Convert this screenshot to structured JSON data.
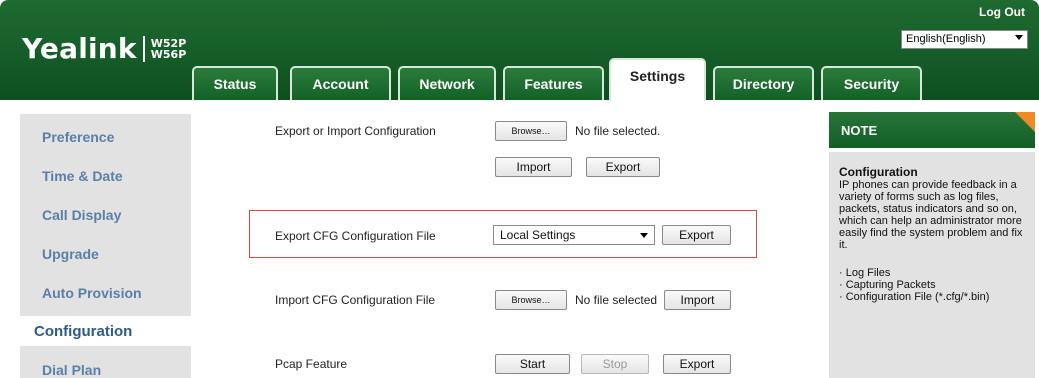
{
  "header": {
    "logo_text": "Yealink",
    "model_line1": "W52P",
    "model_line2": "W56P",
    "logout": "Log Out",
    "language": "English(English)"
  },
  "tabs": [
    {
      "label": "Status",
      "active": false
    },
    {
      "label": "Account",
      "active": false
    },
    {
      "label": "Network",
      "active": false
    },
    {
      "label": "Features",
      "active": false
    },
    {
      "label": "Settings",
      "active": true
    },
    {
      "label": "Directory",
      "active": false
    },
    {
      "label": "Security",
      "active": false
    }
  ],
  "sidebar": {
    "items": [
      {
        "label": "Preference"
      },
      {
        "label": "Time & Date"
      },
      {
        "label": "Call Display"
      },
      {
        "label": "Upgrade"
      },
      {
        "label": "Auto Provision"
      },
      {
        "label": "Configuration",
        "active": true
      },
      {
        "label": "Dial Plan"
      }
    ]
  },
  "main": {
    "export_import": {
      "label": "Export or Import Configuration",
      "browse": "Browse…",
      "file_status": "No file selected.",
      "import": "Import",
      "export": "Export"
    },
    "export_cfg": {
      "label": "Export CFG Configuration File",
      "selected": "Local Settings",
      "export": "Export"
    },
    "import_cfg": {
      "label": "Import CFG Configuration File",
      "browse": "Browse…",
      "file_status": "No file selected",
      "import": "Import"
    },
    "pcap": {
      "label": "Pcap Feature",
      "start": "Start",
      "stop": "Stop",
      "export": "Export"
    }
  },
  "note": {
    "heading": "NOTE",
    "title": "Configuration",
    "body": "IP phones can provide feedback in a variety of forms such as log files, packets, status indicators and so on, which can help an administrator more easily find the system problem and fix it.",
    "list": [
      "· Log Files",
      "· Capturing Packets",
      "· Configuration File (*.cfg/*.bin)"
    ]
  },
  "colors": {
    "header_green": "#17602a",
    "note_accent": "#f08a24",
    "highlight_border": "#d04a4a",
    "sidebar_link": "#5a7fa8"
  }
}
